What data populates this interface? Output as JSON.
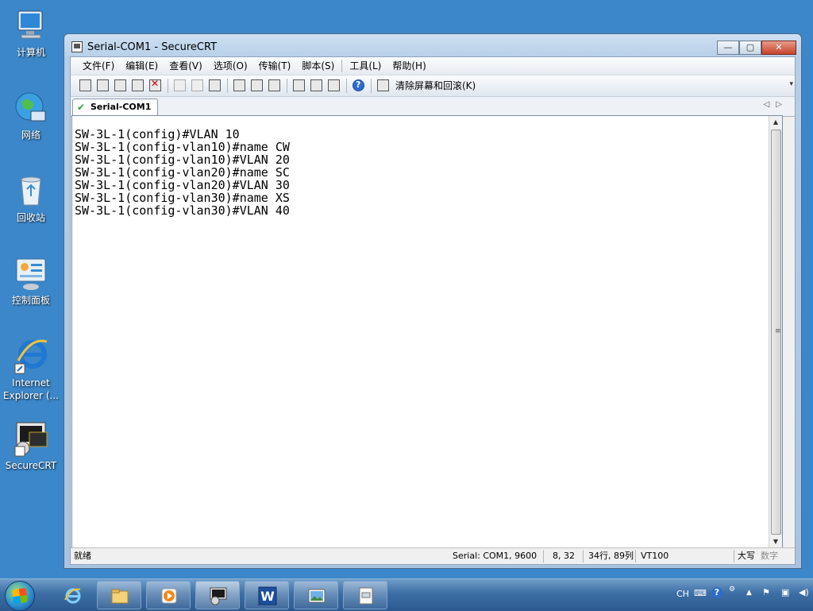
{
  "desktop": {
    "icons": [
      {
        "label": "计算机"
      },
      {
        "label": "网络"
      },
      {
        "label": "回收站"
      },
      {
        "label": "控制面板"
      },
      {
        "label": "Internet Explorer (..."
      },
      {
        "label": "SecureCRT"
      }
    ]
  },
  "window": {
    "title": "Serial-COM1 - SecureCRT",
    "controls": {
      "minimize": "—",
      "maximize": "▢",
      "close": "✕"
    }
  },
  "menu": {
    "items": [
      {
        "label": "文件(F)"
      },
      {
        "label": "编辑(E)"
      },
      {
        "label": "查看(V)"
      },
      {
        "label": "选项(O)"
      },
      {
        "label": "传输(T)"
      },
      {
        "label": "脚本(S)"
      },
      {
        "label": "工具(L)"
      },
      {
        "label": "帮助(H)"
      }
    ]
  },
  "toolbar": {
    "clear_label": "清除屏幕和回滚(K)",
    "overflow": "▾"
  },
  "tabs": [
    {
      "label": "Serial-COM1",
      "active": true
    }
  ],
  "tab_nav": {
    "prev": "◁",
    "next": "▷"
  },
  "terminal": {
    "lines": [
      "SW-3L-1(config)#VLAN 10",
      "SW-3L-1(config-vlan10)#name CW",
      "SW-3L-1(config-vlan10)#VLAN 20",
      "SW-3L-1(config-vlan20)#name SC",
      "SW-3L-1(config-vlan20)#VLAN 30",
      "SW-3L-1(config-vlan30)#name XS",
      "SW-3L-1(config-vlan30)#VLAN 40"
    ]
  },
  "scrollbar": {
    "up": "▲",
    "down": "▼",
    "grip": "≡"
  },
  "status": {
    "ready": "就绪",
    "connection": "Serial: COM1, 9600",
    "cursor": "8,  32",
    "size": "34行, 89列",
    "emulation": "VT100",
    "caps": "大写",
    "num": "数字"
  },
  "taskbar": {
    "tray": {
      "lang": "CH",
      "help": "?",
      "up": "▲"
    }
  },
  "colors": {
    "desktop": "#3b87c9",
    "taskbar": "#3c6ea4",
    "terminal_bg": "#ffffff"
  }
}
